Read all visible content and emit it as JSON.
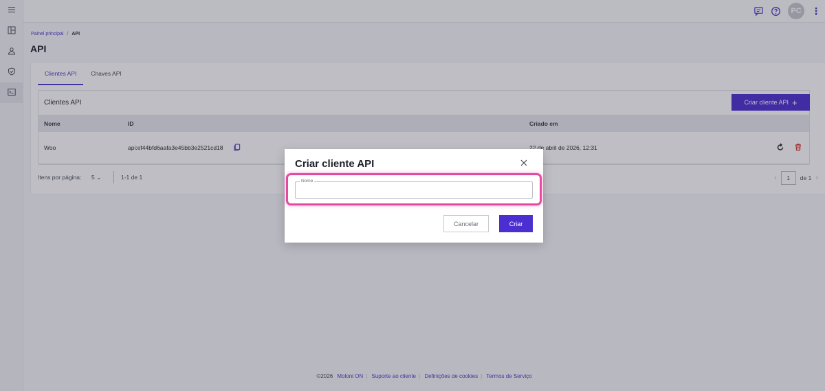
{
  "topbar": {
    "icons": [
      "chat-icon",
      "help-icon"
    ],
    "avatar_initials": "PC"
  },
  "sidebar": {
    "items": [
      {
        "icon": "menu-icon"
      },
      {
        "icon": "dashboard-icon"
      },
      {
        "icon": "user-icon"
      },
      {
        "icon": "shield-icon"
      },
      {
        "icon": "api-console-icon",
        "selected": true
      }
    ]
  },
  "breadcrumb": {
    "home": "Painel principal",
    "separator": "/",
    "current": "API"
  },
  "page": {
    "title": "API"
  },
  "tabs": [
    {
      "label": "Clientes API",
      "active": true
    },
    {
      "label": "Chaves API",
      "active": false
    }
  ],
  "clients_section": {
    "title": "Clientes API",
    "create_button": "Criar cliente API",
    "columns": [
      "Nome",
      "ID",
      "Criado em"
    ],
    "rows": [
      {
        "name": "Woo",
        "id": "api:ef44bfd6aafa3e45bb3e2521cd18",
        "created": "22 de abril de 2026, 12:31"
      }
    ]
  },
  "pagination": {
    "per_page_label": "Itens por página:",
    "per_page_value": "5",
    "range": "1-1 de 1",
    "page": "1",
    "of_label": "de 1"
  },
  "footer": {
    "copyright": "©2026",
    "links": [
      "Moloni ON",
      "Suporte ao cliente",
      "Definições de cookies",
      "Termos de Serviço"
    ]
  },
  "modal": {
    "title": "Criar cliente API",
    "field_label": "Nome",
    "field_value": "",
    "cancel": "Cancelar",
    "submit": "Criar"
  },
  "colors": {
    "accent": "#4c2fd0",
    "highlight": "#e64aa0",
    "delete": "#d9302c"
  }
}
